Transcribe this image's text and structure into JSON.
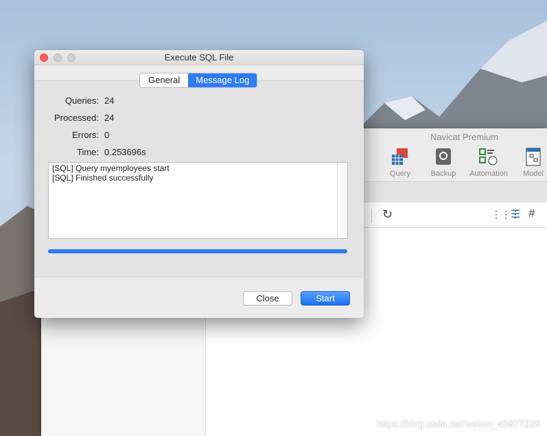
{
  "background_app": {
    "title": "Navicat Premium",
    "toolbar": [
      {
        "label": "Query",
        "icon": "query-icon"
      },
      {
        "label": "Backup",
        "icon": "backup-icon"
      },
      {
        "label": "Automation",
        "icon": "automation-icon"
      },
      {
        "label": "Model",
        "icon": "model-icon"
      }
    ]
  },
  "dialog": {
    "title": "Execute SQL File",
    "tabs": [
      {
        "label": "General",
        "active": false
      },
      {
        "label": "Message Log",
        "active": true
      }
    ],
    "stats": [
      {
        "label": "Queries:",
        "value": "24"
      },
      {
        "label": "Processed:",
        "value": "24"
      },
      {
        "label": "Errors:",
        "value": "0"
      },
      {
        "label": "Time:",
        "value": "0.253696s"
      }
    ],
    "log": [
      "[SQL] Query myemployees start",
      "[SQL] Finished successfully"
    ],
    "progress_percent": 100,
    "accent": "#2e7cf6",
    "buttons": {
      "close": "Close",
      "start": "Start"
    }
  },
  "watermark": "https://blog.csdn.net/weixin_45877226"
}
